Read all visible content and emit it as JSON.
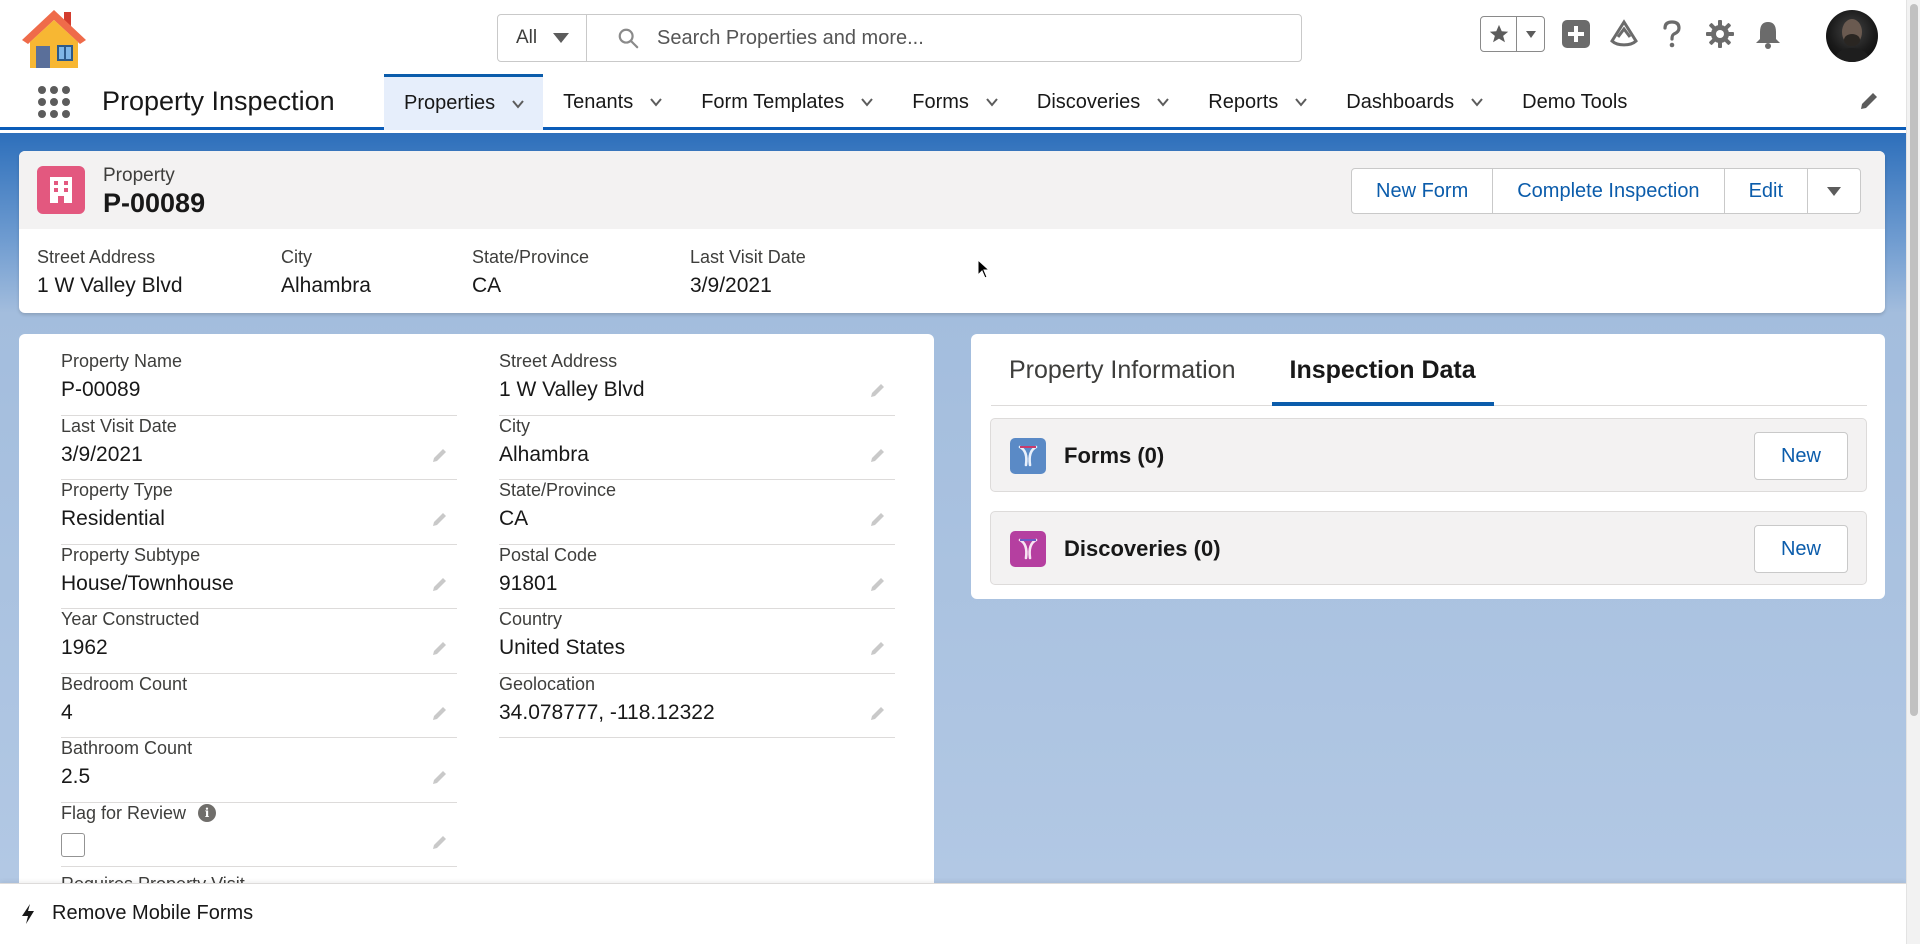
{
  "header": {
    "search_scope": "All",
    "search_placeholder": "Search Properties and more..."
  },
  "app": {
    "name": "Property Inspection",
    "nav": [
      {
        "label": "Properties",
        "active": true
      },
      {
        "label": "Tenants"
      },
      {
        "label": "Form Templates"
      },
      {
        "label": "Forms"
      },
      {
        "label": "Discoveries"
      },
      {
        "label": "Reports"
      },
      {
        "label": "Dashboards"
      },
      {
        "label": "Demo Tools"
      }
    ]
  },
  "record": {
    "object_label": "Property",
    "name": "P-00089",
    "actions": [
      "New Form",
      "Complete Inspection",
      "Edit"
    ],
    "highlights": [
      {
        "label": "Street Address",
        "value": "1 W Valley Blvd"
      },
      {
        "label": "City",
        "value": "Alhambra"
      },
      {
        "label": "State/Province",
        "value": "CA"
      },
      {
        "label": "Last Visit Date",
        "value": "3/9/2021"
      }
    ]
  },
  "details": {
    "left": [
      {
        "label": "Property Name",
        "value": "P-00089"
      },
      {
        "label": "Last Visit Date",
        "value": "3/9/2021"
      },
      {
        "label": "Property Type",
        "value": "Residential"
      },
      {
        "label": "Property Subtype",
        "value": "House/Townhouse"
      },
      {
        "label": "Year Constructed",
        "value": "1962"
      },
      {
        "label": "Bedroom Count",
        "value": "4"
      },
      {
        "label": "Bathroom Count",
        "value": "2.5"
      },
      {
        "label": "Flag for Review",
        "value": ""
      }
    ],
    "right": [
      {
        "label": "Street Address",
        "value": "1 W Valley Blvd"
      },
      {
        "label": "City",
        "value": "Alhambra"
      },
      {
        "label": "State/Province",
        "value": "CA"
      },
      {
        "label": "Postal Code",
        "value": "91801"
      },
      {
        "label": "Country",
        "value": "United States"
      },
      {
        "label": "Geolocation",
        "value": "34.078777, -118.12322"
      }
    ],
    "next_label": "Requires Property Visit"
  },
  "tabs": {
    "items": [
      "Property Information",
      "Inspection Data"
    ],
    "active": "Inspection Data"
  },
  "related": [
    {
      "title": "Forms (0)",
      "button": "New",
      "icon_color": "#5a8ac6"
    },
    {
      "title": "Discoveries (0)",
      "button": "New",
      "icon_color": "#b53fa0"
    }
  ],
  "utility": {
    "item": "Remove Mobile Forms"
  }
}
